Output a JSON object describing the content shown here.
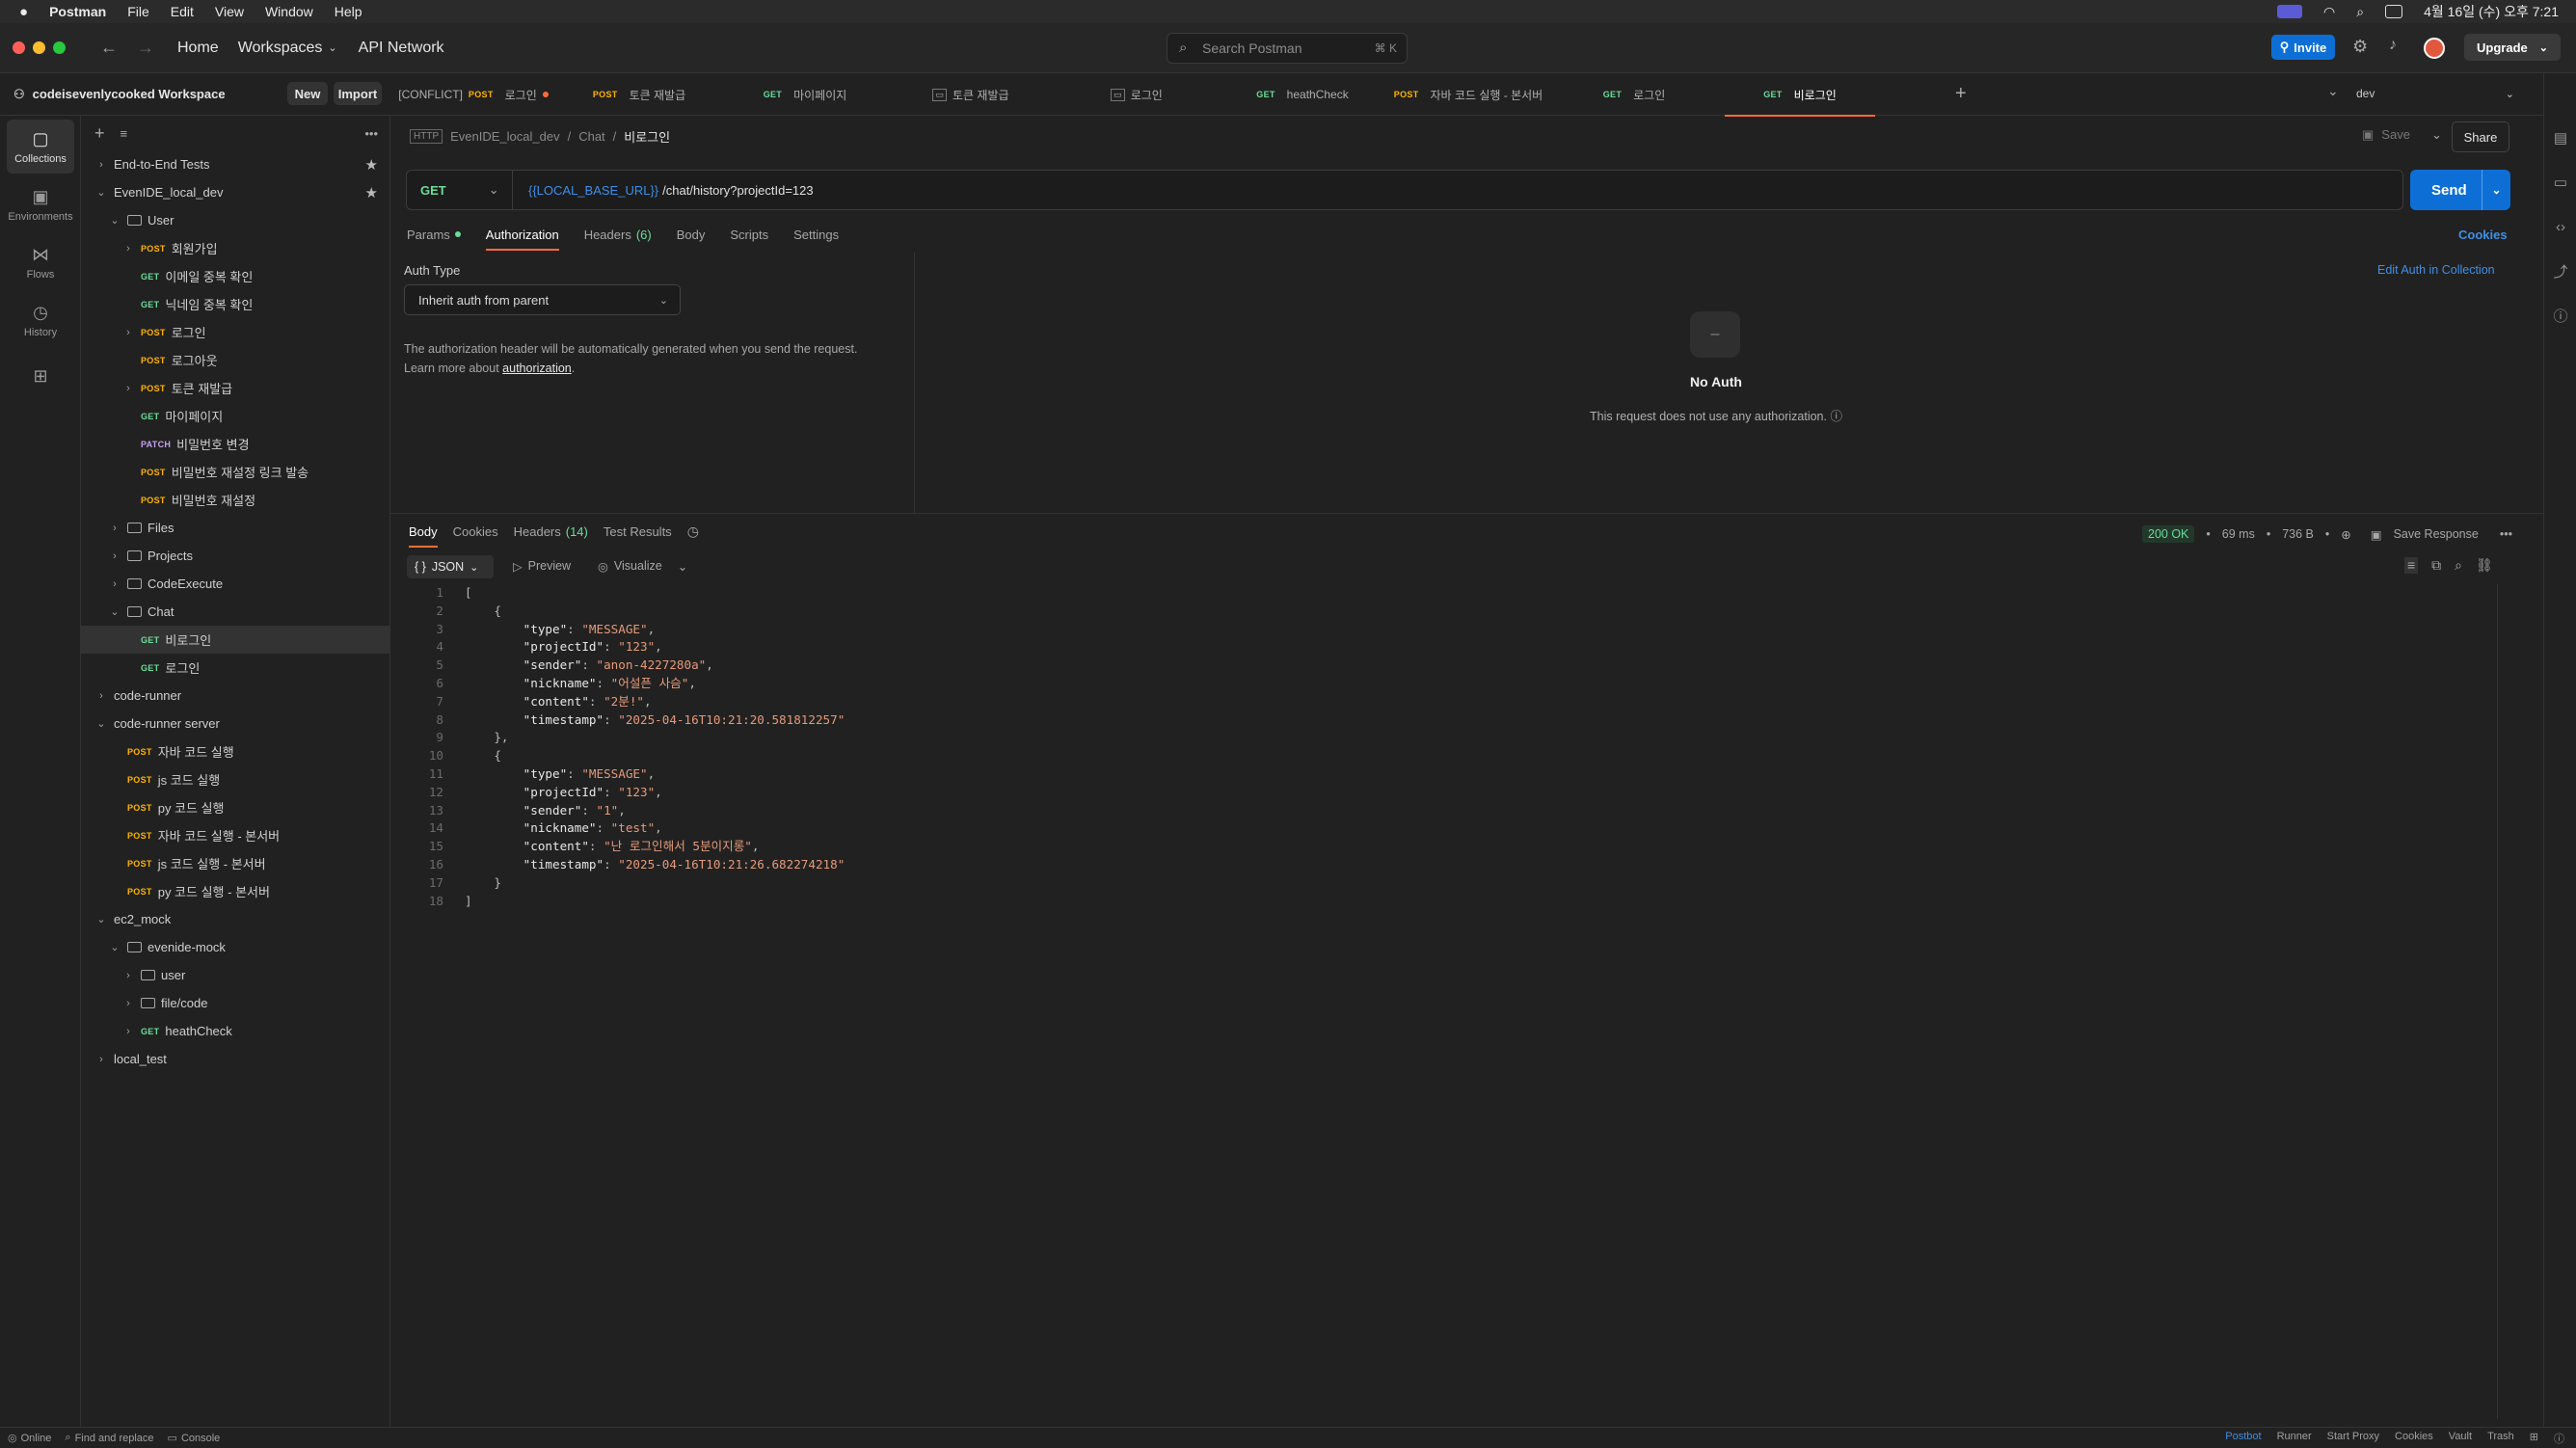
{
  "mac_menu": {
    "app": "Postman",
    "items": [
      "File",
      "Edit",
      "View",
      "Window",
      "Help"
    ],
    "clock": "4월 16일 (수) 오후 7:21"
  },
  "nav": {
    "home": "Home",
    "workspaces": "Workspaces",
    "api_network": "API Network",
    "search_placeholder": "Search Postman",
    "search_shortcut": "⌘ K",
    "invite": "Invite",
    "upgrade": "Upgrade"
  },
  "workspace": {
    "name": "codeisevenlycooked Workspace",
    "new": "New",
    "import": "Import"
  },
  "rail": [
    {
      "label": "Collections",
      "icon": "collections-icon"
    },
    {
      "label": "Environments",
      "icon": "environments-icon"
    },
    {
      "label": "Flows",
      "icon": "flows-icon"
    },
    {
      "label": "History",
      "icon": "history-icon"
    }
  ],
  "tree": [
    {
      "label": "End-to-End Tests",
      "level": 0,
      "kind": "col",
      "chev": ">",
      "star": true
    },
    {
      "label": "EvenIDE_local_dev",
      "level": 0,
      "kind": "col",
      "chev": "v",
      "star": true
    },
    {
      "label": "User",
      "level": 1,
      "kind": "folder",
      "chev": "v"
    },
    {
      "label": "회원가입",
      "level": 2,
      "kind": "req",
      "method": "POST",
      "chev": ">"
    },
    {
      "label": "이메일 중복 확인",
      "level": 2,
      "kind": "req",
      "method": "GET"
    },
    {
      "label": "닉네임 중복 확인",
      "level": 2,
      "kind": "req",
      "method": "GET"
    },
    {
      "label": "로그인",
      "level": 2,
      "kind": "req",
      "method": "POST",
      "chev": ">"
    },
    {
      "label": "로그아웃",
      "level": 2,
      "kind": "req",
      "method": "POST"
    },
    {
      "label": "토큰 재발급",
      "level": 2,
      "kind": "req",
      "method": "POST",
      "chev": ">"
    },
    {
      "label": "마이페이지",
      "level": 2,
      "kind": "req",
      "method": "GET"
    },
    {
      "label": "비밀번호 변경",
      "level": 2,
      "kind": "req",
      "method": "PATCH"
    },
    {
      "label": "비밀번호 재설정 링크 발송",
      "level": 2,
      "kind": "req",
      "method": "POST"
    },
    {
      "label": "비밀번호 재설정",
      "level": 2,
      "kind": "req",
      "method": "POST"
    },
    {
      "label": "Files",
      "level": 1,
      "kind": "folder",
      "chev": ">"
    },
    {
      "label": "Projects",
      "level": 1,
      "kind": "folder",
      "chev": ">"
    },
    {
      "label": "CodeExecute",
      "level": 1,
      "kind": "folder",
      "chev": ">"
    },
    {
      "label": "Chat",
      "level": 1,
      "kind": "folder",
      "chev": "v"
    },
    {
      "label": "비로그인",
      "level": 2,
      "kind": "req",
      "method": "GET",
      "selected": true
    },
    {
      "label": "로그인",
      "level": 2,
      "kind": "req",
      "method": "GET"
    },
    {
      "label": "code-runner",
      "level": 0,
      "kind": "col",
      "chev": ">"
    },
    {
      "label": "code-runner server",
      "level": 0,
      "kind": "col",
      "chev": "v"
    },
    {
      "label": "자바 코드 실행",
      "level": 1,
      "kind": "req",
      "method": "POST"
    },
    {
      "label": "js 코드 실행",
      "level": 1,
      "kind": "req",
      "method": "POST"
    },
    {
      "label": "py 코드 실행",
      "level": 1,
      "kind": "req",
      "method": "POST"
    },
    {
      "label": "자바 코드 실행 - 본서버",
      "level": 1,
      "kind": "req",
      "method": "POST"
    },
    {
      "label": "js 코드 실행 - 본서버",
      "level": 1,
      "kind": "req",
      "method": "POST"
    },
    {
      "label": "py 코드 실행 - 본서버",
      "level": 1,
      "kind": "req",
      "method": "POST"
    },
    {
      "label": "ec2_mock",
      "level": 0,
      "kind": "col",
      "chev": "v"
    },
    {
      "label": "evenide-mock",
      "level": 1,
      "kind": "folder",
      "chev": "v"
    },
    {
      "label": "user",
      "level": 2,
      "kind": "folder",
      "chev": ">"
    },
    {
      "label": "file/code",
      "level": 2,
      "kind": "folder",
      "chev": ">"
    },
    {
      "label": "heathCheck",
      "level": 2,
      "kind": "req",
      "method": "GET",
      "chev": ">"
    },
    {
      "label": "local_test",
      "level": 0,
      "kind": "col",
      "chev": ">"
    }
  ],
  "tabs": [
    {
      "prefix": "[CONFLICT]",
      "method": "POST",
      "label": "로그인",
      "dot": true
    },
    {
      "method": "POST",
      "label": "토큰 재발급"
    },
    {
      "method": "GET",
      "label": "마이페이지"
    },
    {
      "method": "",
      "label": "토큰 재발급"
    },
    {
      "method": "",
      "label": "로그인"
    },
    {
      "method": "GET",
      "label": "heathCheck"
    },
    {
      "method": "POST",
      "label": "자바 코드 실행 - 본서버"
    },
    {
      "method": "GET",
      "label": "로그인"
    },
    {
      "method": "GET",
      "label": "비로그인",
      "active": true
    }
  ],
  "env": "dev",
  "breadcrumb": [
    "EvenIDE_local_dev",
    "Chat",
    "비로그인"
  ],
  "request": {
    "method": "GET",
    "url_var": "{{LOCAL_BASE_URL}}",
    "url_path": "/chat/history?projectId=123",
    "send": "Send",
    "save": "Save",
    "share": "Share"
  },
  "req_tabs": [
    "Params",
    "Authorization",
    "Headers",
    "Body",
    "Scripts",
    "Settings"
  ],
  "headers_count": "(6)",
  "cookies": "Cookies",
  "auth": {
    "type_label": "Auth Type",
    "selected": "Inherit auth from parent",
    "desc": "The authorization header will be automatically generated when you send the request.",
    "learn": "Learn more about",
    "learn_link": "authorization",
    "edit_link": "Edit Auth in Collection",
    "no_auth_title": "No Auth",
    "no_auth_desc": "This request does not use any authorization.",
    "no_auth_glyph": "–"
  },
  "resp_tabs": [
    "Body",
    "Cookies",
    "Headers",
    "Test Results"
  ],
  "resp_headers_count": "(14)",
  "response": {
    "status": "200 OK",
    "time": "69 ms",
    "size": "736 B",
    "save": "Save Response",
    "format": "JSON",
    "preview": "Preview",
    "visualize": "Visualize"
  },
  "json_lines": [
    "[",
    "    {",
    "        \"type\": \"MESSAGE\",",
    "        \"projectId\": \"123\",",
    "        \"sender\": \"anon-4227280a\",",
    "        \"nickname\": \"어설픈 사슴\",",
    "        \"content\": \"2분!\",",
    "        \"timestamp\": \"2025-04-16T10:21:20.581812257\"",
    "    },",
    "    {",
    "        \"type\": \"MESSAGE\",",
    "        \"projectId\": \"123\",",
    "        \"sender\": \"1\",",
    "        \"nickname\": \"test\",",
    "        \"content\": \"난 로그인해서 5분이지롱\",",
    "        \"timestamp\": \"2025-04-16T10:21:26.682274218\"",
    "    }",
    "]"
  ],
  "statusbar": {
    "left": [
      "Online",
      "Find and replace",
      "Console"
    ],
    "right": [
      "Postbot",
      "Runner",
      "Start Proxy",
      "Cookies",
      "Vault",
      "Trash"
    ]
  },
  "colors": {
    "accent": "#ff6c37",
    "send": "#0d6fd6",
    "get": "#6bdd9a",
    "post": "#ffb400",
    "ok": "#6bdd9a"
  }
}
